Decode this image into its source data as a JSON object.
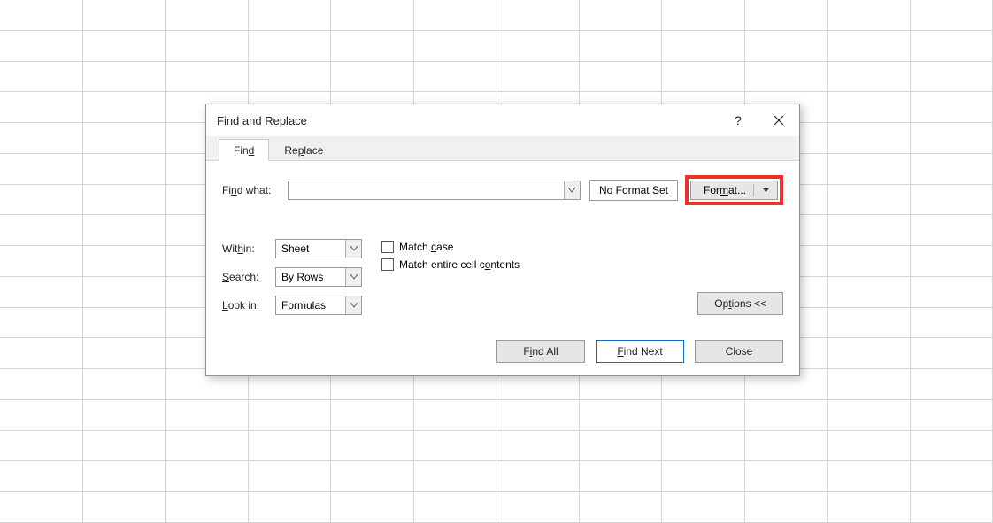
{
  "dialog": {
    "title": "Find and Replace",
    "tabs": {
      "find": "Find",
      "replace": "Replace"
    },
    "find_what_label": "Find what:",
    "find_what_value": "",
    "no_format": "No Format Set",
    "format_button": "Format...",
    "within": {
      "label": "Within:",
      "value": "Sheet"
    },
    "search": {
      "label": "Search:",
      "value": "By Rows"
    },
    "look_in": {
      "label": "Look in:",
      "value": "Formulas"
    },
    "match_case": "Match case",
    "match_entire": "Match entire cell contents",
    "options": "Options <<",
    "find_all": "Find All",
    "find_next": "Find Next",
    "close": "Close"
  }
}
